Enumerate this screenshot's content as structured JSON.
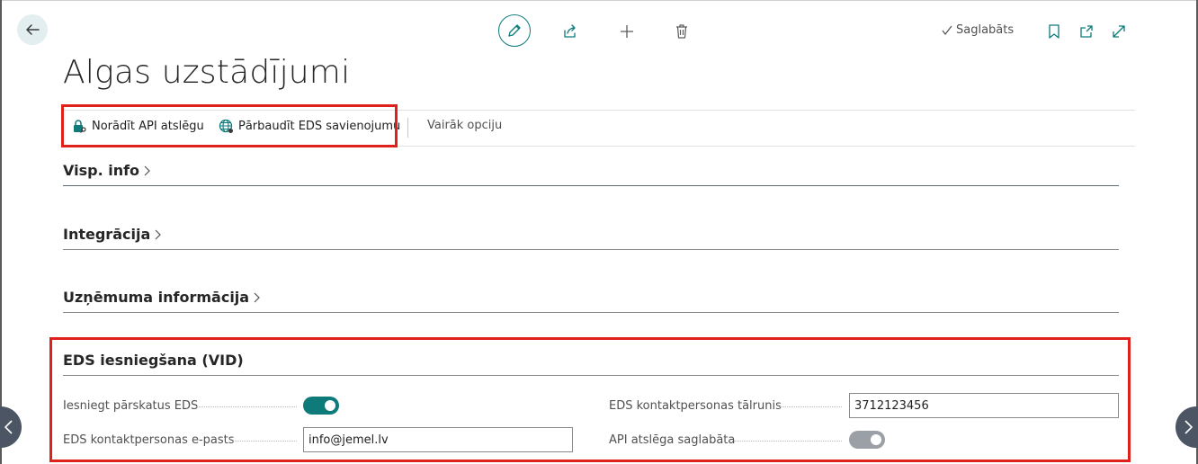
{
  "toolbar": {
    "saved_status": "Saglabāts",
    "icons": [
      "back-arrow-icon",
      "pencil-icon",
      "share-icon",
      "plus-icon",
      "trash-icon",
      "bookmark-icon",
      "popout-icon",
      "expand-icon"
    ]
  },
  "page": {
    "title": "Algas uzstādījumi"
  },
  "actions": {
    "api_key_label": "Norādīt API atslēgu",
    "check_eds_label": "Pārbaudīt EDS savienojumu",
    "more_options_label": "Vairāk opciju"
  },
  "fasttabs": {
    "general": "Visp. info",
    "integration": "Integrācija",
    "company": "Uzņēmuma informācija",
    "eds": "EDS iesniegšana (VID)"
  },
  "eds_fields": {
    "submit_reports_label": "Iesniegt pārskatus EDS",
    "submit_reports_on": true,
    "contact_email_label": "EDS kontaktpersonas e-pasts",
    "contact_email_value": "info@jemel.lv",
    "contact_phone_label": "EDS kontaktpersonas tālrunis",
    "contact_phone_value": "3712123456",
    "api_key_saved_label": "API atslēga saglabāta",
    "api_key_saved_on": true
  },
  "colors": {
    "accent": "#0e7a7a",
    "highlight": "#e0201b",
    "toggle_disabled": "#9aa0a6"
  }
}
